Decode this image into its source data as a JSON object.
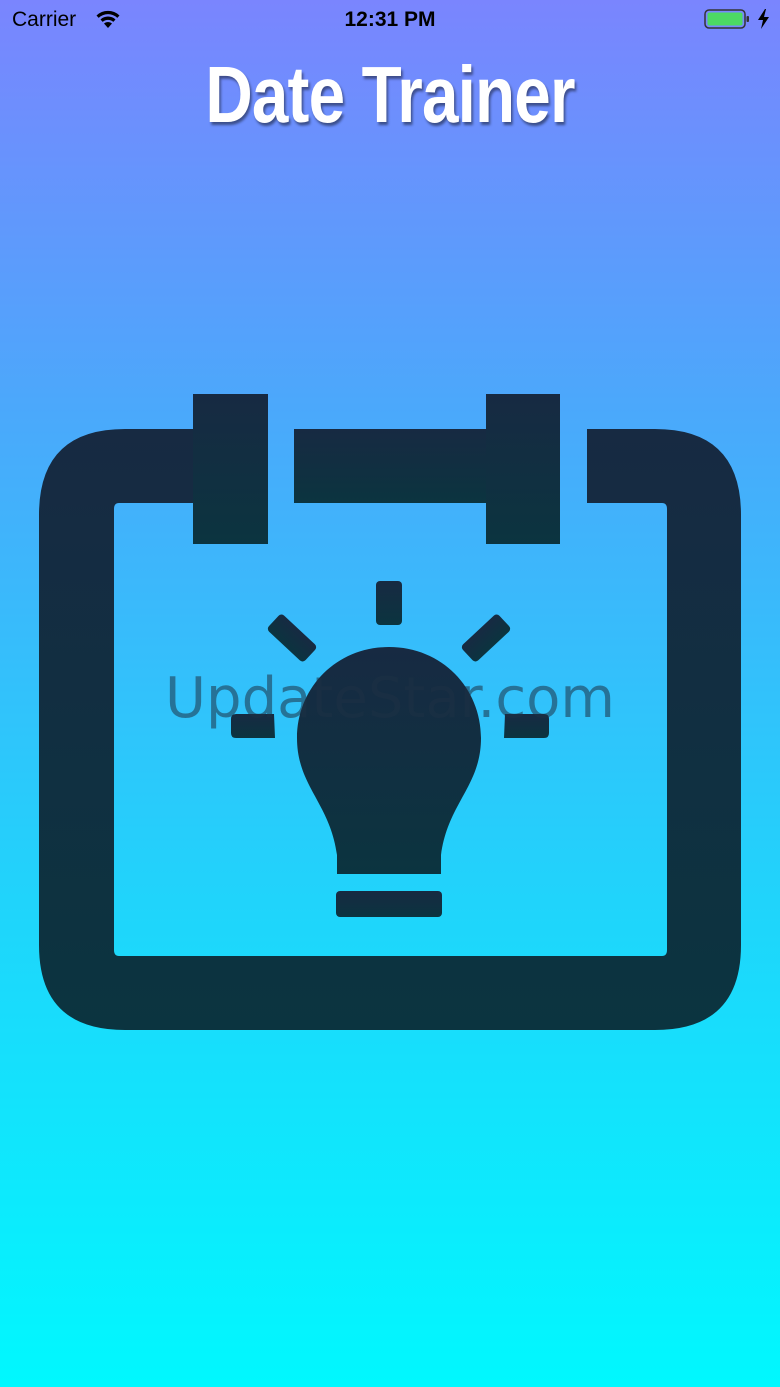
{
  "status_bar": {
    "carrier": "Carrier",
    "time": "12:31 PM",
    "battery_color": "#4cd964"
  },
  "app": {
    "title": "Date Trainer",
    "logo_icon": "calendar-lightbulb-icon",
    "icon_color": "#152a3d"
  },
  "watermark": "UpdateStar.com",
  "theme": {
    "gradient_top": "#7a85fe",
    "gradient_bottom": "#00f8fe"
  }
}
